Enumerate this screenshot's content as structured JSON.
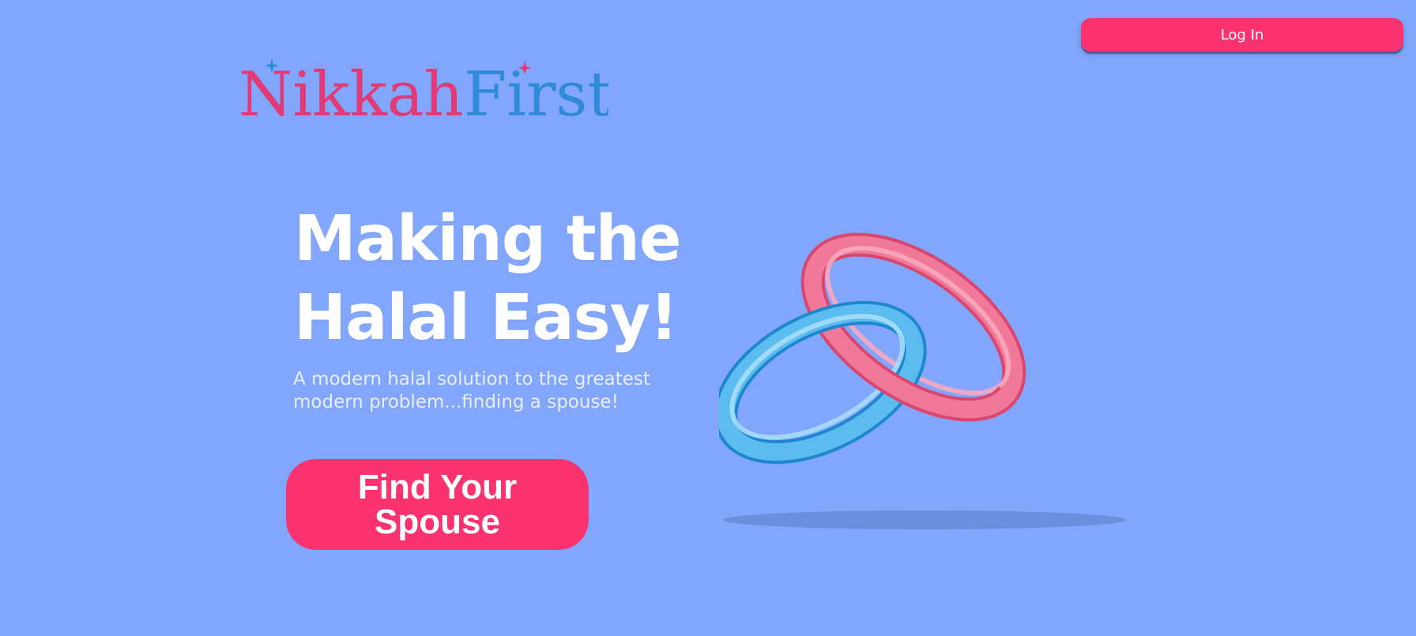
{
  "header": {
    "login_label": "Log In"
  },
  "logo": {
    "word1": "Nikkah",
    "word2": "First",
    "color1": "#e23a76",
    "color2": "#2f8ad8"
  },
  "hero": {
    "headline_line1": "Making the",
    "headline_line2": "Halal Easy!",
    "subtitle": "A modern halal solution to the greatest modern problem...finding a spouse!",
    "cta_line1": "Find Your",
    "cta_line2": "Spouse"
  },
  "illustration": {
    "name": "wedding-rings-icon",
    "ring1_color": "#f2648e",
    "ring2_color": "#4fb3ea"
  },
  "colors": {
    "background": "#81a6fb",
    "accent": "#fb3270",
    "text": "#ffffff"
  }
}
